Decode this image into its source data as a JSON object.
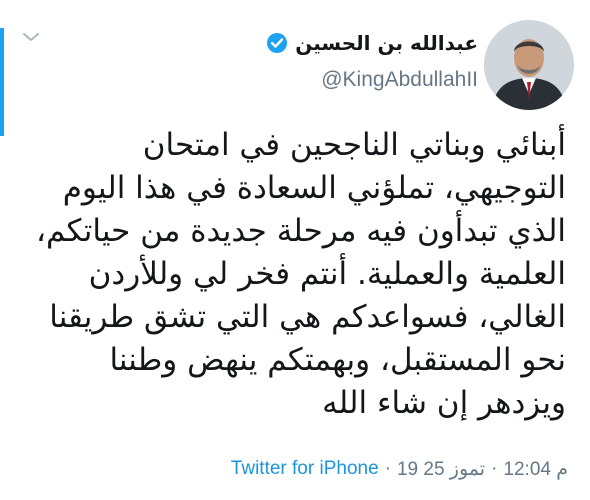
{
  "author": {
    "display_name": "عبدالله بن الحسين",
    "handle": "@KingAbdullahII"
  },
  "icons": {
    "verified": "verified-badge-icon",
    "chevron": "chevron-down-icon"
  },
  "tweet": {
    "lines": [
      "أبنائي وبناتي الناجحين في امتحان",
      "التوجيهي، تملؤني السعادة في هذا اليوم",
      "الذي تبدأون فيه مرحلة جديدة من حياتكم،",
      "العلمية والعملية. أنتم فخر لي وللأردن",
      "الغالي، فسواعدكم هي التي تشق طريقنا",
      "نحو المستقبل، وبهمتكم ينهض وطننا",
      "ويزدهر إن شاء الله"
    ],
    "source": "Twitter for iPhone",
    "date": "19 تموز 25",
    "time": "12:04 م",
    "separator": "·"
  },
  "colors": {
    "accent": "#1da1f2",
    "link": "#1b95e0",
    "muted": "#657786",
    "text": "#14171a"
  }
}
